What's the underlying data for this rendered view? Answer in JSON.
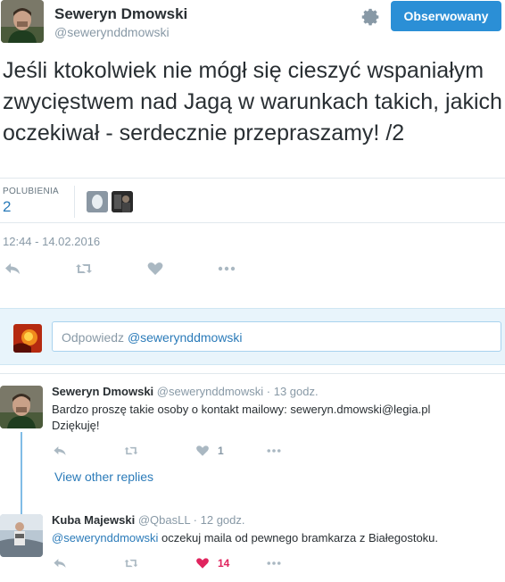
{
  "tweet": {
    "author_name": "Seweryn Dmowski",
    "author_handle": "@sewerynddmowski",
    "follow_label": "Obserwowany",
    "text": "Jeśli ktokolwiek nie mógł się cieszyć wspaniałym zwycięstwem nad Jagą w warunkach takich, jakich oczekiwał - serdecznie przepraszamy! /2",
    "likes_label": "POLUBIENIA",
    "likes_count": "2",
    "timestamp": "12:44 - 14.02.2016",
    "icons": [
      "reply-icon",
      "retweet-icon",
      "heart-icon",
      "more-icon",
      "gear-icon"
    ]
  },
  "reply_box": {
    "placeholder_prefix": "Odpowiedz",
    "placeholder_mention": "@sewerynddmowski"
  },
  "replies": [
    {
      "name": "Seweryn Dmowski",
      "meta": "@sewerynddmowski · 13 godz.",
      "text_line1": "Bardzo proszę takie osoby o kontakt mailowy: seweryn.dmowski@legia.pl",
      "text_line2": "Dziękuję!",
      "like_count": "1",
      "view_more": "View other replies"
    },
    {
      "name": "Kuba Majewski",
      "meta": "@QbasLL · 12 godz.",
      "mention": "@sewerynddmowski",
      "text": " oczekuj maila od pewnego bramkarza z Białegostoku.",
      "like_count": "14"
    }
  ],
  "colors": {
    "accent": "#2b8fd6",
    "link": "#2b7bb9",
    "muted": "#8899a6",
    "like_active": "#e0245e"
  }
}
